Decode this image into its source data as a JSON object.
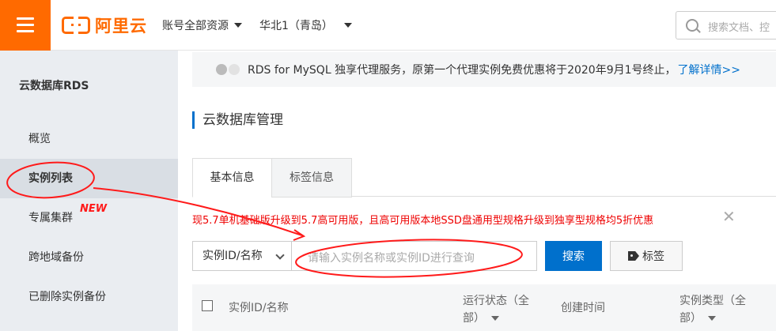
{
  "header": {
    "logo_text": "阿里云",
    "account_scope": "账号全部资源",
    "region": "华北1（青岛）",
    "search_placeholder": "搜索文档、控"
  },
  "sidebar": {
    "title": "云数据库RDS",
    "items": [
      {
        "label": "概览"
      },
      {
        "label": "实例列表"
      },
      {
        "label": "专属集群"
      },
      {
        "label": "跨地域备份"
      },
      {
        "label": "已删除实例备份"
      }
    ],
    "new_badge": "NEW"
  },
  "notice": {
    "text": "RDS for MySQL 独享代理服务，原第一个代理实例免费优惠将于2020年9月1号终止，",
    "link": "了解详情>>"
  },
  "page_title": "云数据库管理",
  "tabs": [
    {
      "label": "基本信息"
    },
    {
      "label": "标签信息"
    }
  ],
  "promo": {
    "text": "现5.7单机基础版升级到5.7高可用版，且高可用版本地SSD盘通用型规格升级到独享型规格均5折优惠",
    "close": "✕"
  },
  "filter": {
    "select_value": "实例ID/名称",
    "input_placeholder": "请输入实例名称或实例ID进行查询",
    "search_label": "搜索",
    "tag_label": "标签"
  },
  "table": {
    "columns": [
      {
        "label": "实例ID/名称"
      },
      {
        "label": "运行状态（全",
        "label2": "部）"
      },
      {
        "label": "创建时间"
      },
      {
        "label": "实例类型（全",
        "label2": "部）"
      }
    ]
  },
  "colors": {
    "brand_orange": "#ff6a00",
    "primary_blue": "#0070cc",
    "annotation_red": "#ff1a1a"
  }
}
